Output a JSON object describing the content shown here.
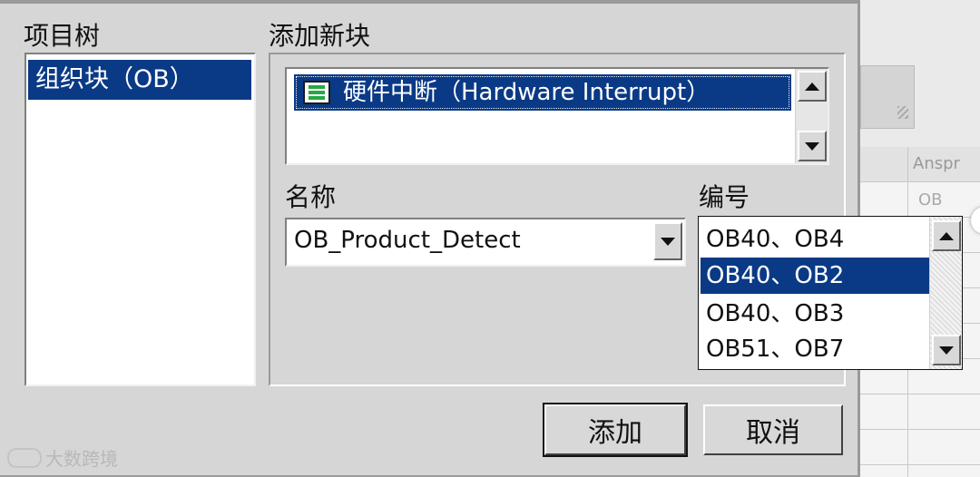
{
  "project_tree": {
    "label": "项目树",
    "items": [
      "组织块（OB）"
    ]
  },
  "add_block": {
    "label": "添加新块",
    "block_types": [
      {
        "label": "硬件中断（Hardware Interrupt）",
        "icon": "hardware-interrupt-block-icon"
      }
    ]
  },
  "name_field": {
    "label": "名称",
    "value": "OB_Product_Detect"
  },
  "number_field": {
    "label": "编号",
    "options": [
      "OB40、OB4",
      "OB40、OB2",
      "OB40、OB3",
      "OB51、OB7"
    ],
    "selected": "OB40、OB2"
  },
  "buttons": {
    "add": "添加",
    "cancel": "取消"
  },
  "background_window": {
    "cell_1": "Anspr",
    "cell_2": "OB"
  },
  "watermark": "大数跨境",
  "colors": {
    "selection": "#0a3a86",
    "dialog_bg": "#d6d6d6",
    "icon_green": "#28a745"
  }
}
